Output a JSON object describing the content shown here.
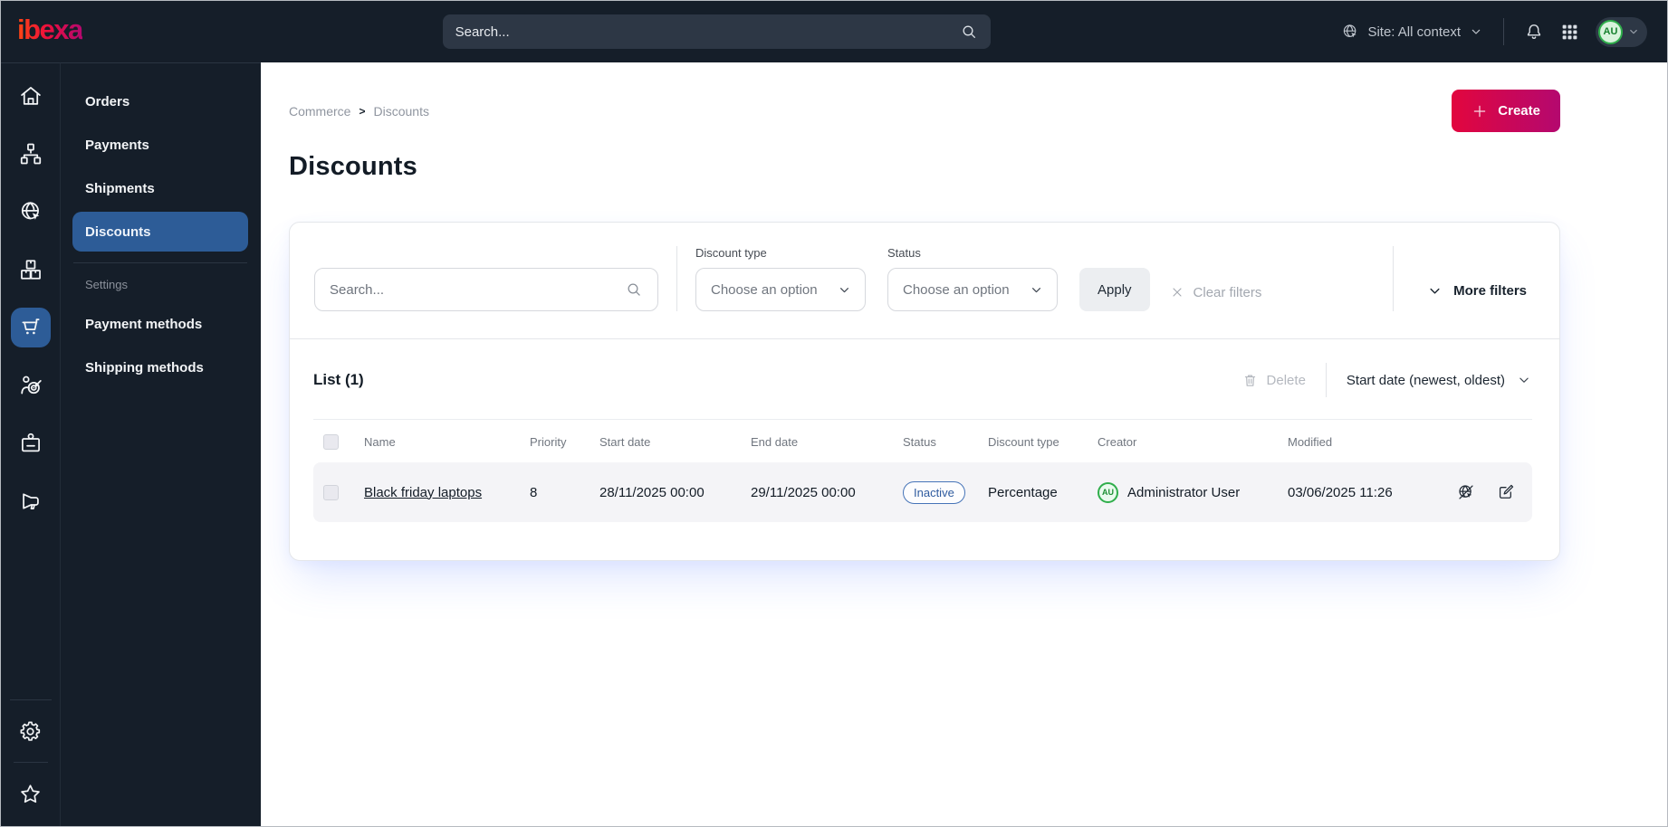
{
  "topbar": {
    "logo_text": "ibexa",
    "search_placeholder": "Search...",
    "site_selector": "Site: All context",
    "avatar_initials": "AU",
    "icons": [
      "site-globe-icon",
      "chevron-down-icon",
      "notifications-bell-icon",
      "apps-grid-icon",
      "search-icon"
    ]
  },
  "rail": {
    "icons": [
      {
        "name": "home-icon",
        "active": false
      },
      {
        "name": "content-tree-icon",
        "active": false
      },
      {
        "name": "site-globe-cursor-icon",
        "active": false
      },
      {
        "name": "products-boxes-icon",
        "active": false
      },
      {
        "name": "commerce-cart-icon",
        "active": true
      },
      {
        "name": "customer-target-icon",
        "active": false
      },
      {
        "name": "id-badge-icon",
        "active": false
      },
      {
        "name": "marketing-megaphone-icon",
        "active": false
      }
    ],
    "bottom_icons": [
      {
        "name": "gear-icon"
      },
      {
        "name": "star-icon"
      }
    ]
  },
  "menu": {
    "items": [
      {
        "label": "Orders",
        "active": false
      },
      {
        "label": "Payments",
        "active": false
      },
      {
        "label": "Shipments",
        "active": false
      },
      {
        "label": "Discounts",
        "active": true
      }
    ],
    "section_label": "Settings",
    "section_items": [
      {
        "label": "Payment methods"
      },
      {
        "label": "Shipping methods"
      }
    ]
  },
  "breadcrumb": {
    "items": [
      "Commerce",
      "Discounts"
    ],
    "separator": ">"
  },
  "page": {
    "title": "Discounts",
    "create_label": "Create"
  },
  "filters": {
    "search_placeholder": "Search...",
    "discount_type_label": "Discount type",
    "discount_type_value": "Choose an option",
    "status_label": "Status",
    "status_value": "Choose an option",
    "apply_label": "Apply",
    "clear_filters_label": "Clear filters",
    "more_filters_label": "More filters"
  },
  "list": {
    "title": "List (1)",
    "delete_label": "Delete",
    "sort_label": "Start date (newest, oldest)",
    "columns": [
      "Name",
      "Priority",
      "Start date",
      "End date",
      "Status",
      "Discount type",
      "Creator",
      "Modified"
    ],
    "rows": [
      {
        "name": "Black friday laptops",
        "priority": "8",
        "start_date": "28/11/2025 00:00",
        "end_date": "29/11/2025 00:00",
        "status": "Inactive",
        "discount_type": "Percentage",
        "creator_initials": "AU",
        "creator": "Administrator User",
        "modified": "03/06/2025 11:26",
        "action_icons": [
          "site-preview-disabled-icon",
          "edit-icon"
        ]
      }
    ]
  },
  "colors": {
    "topbar_bg": "#151e29",
    "active_blue": "#2d5c97",
    "create_gradient_start": "#e2063e",
    "create_gradient_end": "#b4086f",
    "status_badge_blue": "#2f5b9f",
    "avatar_green": "#2fae4b",
    "row_bg": "#f4f4f7"
  }
}
